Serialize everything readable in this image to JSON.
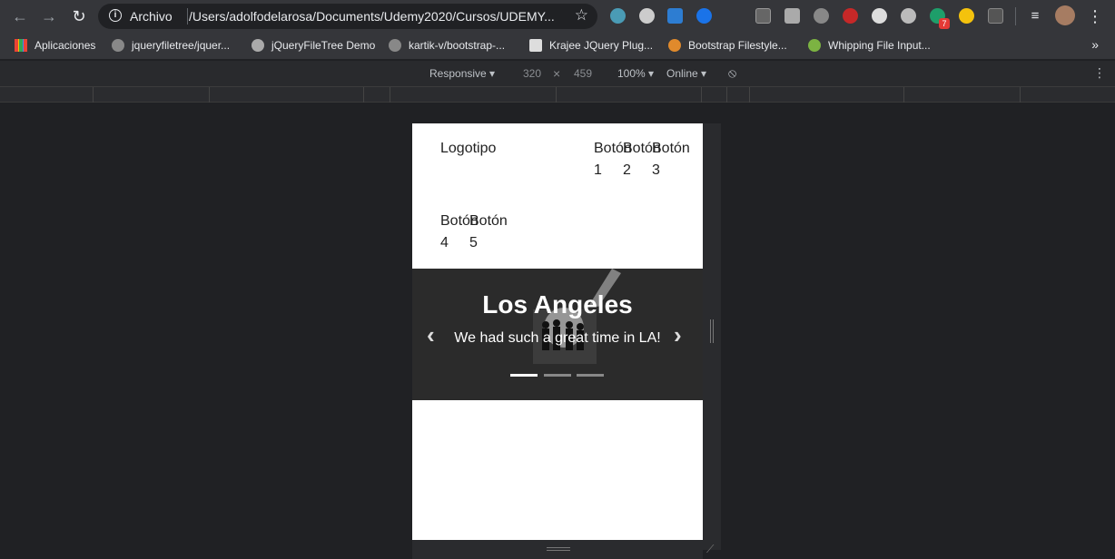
{
  "browser": {
    "omnibox": {
      "label": "Archivo",
      "url": "/Users/adolfodelarosa/Documents/Udemy2020/Cursos/UDEMY..."
    },
    "bookmarks": [
      {
        "label": "Aplicaciones",
        "icon": "apps-grid-icon"
      },
      {
        "label": "jqueryfiletree/jquer...",
        "icon": "github-icon"
      },
      {
        "label": "jQueryFileTree Demo",
        "icon": "globe-icon"
      },
      {
        "label": "kartik-v/bootstrap-...",
        "icon": "github-icon"
      },
      {
        "label": "Krajee JQuery Plug...",
        "icon": "krajee-k-icon"
      },
      {
        "label": "Bootstrap Filestyle...",
        "icon": "filestyle-icon"
      },
      {
        "label": "Whipping File Input...",
        "icon": "leaf-icon"
      }
    ],
    "extension_badge": "7"
  },
  "devtools": {
    "device": "Responsive ▾",
    "width": "320",
    "x": "×",
    "height": "459",
    "zoom": "100% ▾",
    "network": "Online ▾"
  },
  "page": {
    "logo": "Logotipo",
    "buttons": [
      "Botón 1",
      "Botón 2",
      "Botón 3",
      "Botón 4",
      "Botón 5"
    ],
    "carousel": {
      "title": "Los Angeles",
      "caption": "We had such a great time in LA!",
      "prev": "‹",
      "next": "›",
      "active_slide": 1,
      "slide_count": 3
    }
  },
  "colors": {
    "chrome_bg": "#35363a",
    "omnibox_bg": "#202124",
    "page_bg": "#ffffff",
    "carousel_bg": "#2b2b2b"
  }
}
